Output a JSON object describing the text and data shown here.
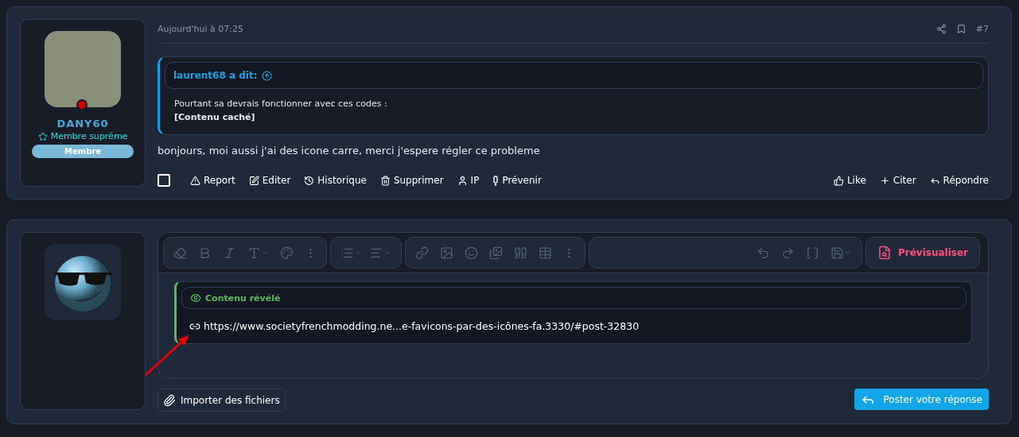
{
  "post": {
    "timestamp": "Aujourd'hui à 07:25",
    "number": "#7",
    "author": {
      "name": "DANY60",
      "title": "Membre suprême",
      "badge": "Membre",
      "online": true
    },
    "quote": {
      "author": "laurent68 a dit:",
      "lines": [
        {
          "text": "Pourtant sa devrais fonctionner avec ces codes :",
          "kind": "plain"
        },
        {
          "text": "[Contenu caché]",
          "kind": "bold"
        }
      ]
    },
    "message": "bonjours, moi aussi j'ai des icone carre, merci j'espere régler ce probleme",
    "select": {
      "checked": false
    },
    "actions": [
      {
        "label": "Report",
        "kind": "report"
      },
      {
        "label": "Editer",
        "kind": "edit"
      },
      {
        "label": "Historique",
        "kind": "history"
      },
      {
        "label": "Supprimer",
        "kind": "delete"
      },
      {
        "label": "IP",
        "kind": "ip"
      },
      {
        "label": "Prévenir",
        "kind": "warn"
      }
    ],
    "reactions": [
      {
        "label": "Like",
        "kind": "like"
      },
      {
        "label": "Citer",
        "kind": "quote"
      },
      {
        "label": "Répondre",
        "kind": "reply"
      }
    ]
  },
  "editor": {
    "preview_button": "Prévisualiser",
    "spoiler": {
      "title": "Contenu révélé",
      "link": "https://www.societyfrenchmodding.ne...e-favicons-par-des-icônes-fa.3330/#post-32830"
    },
    "attach_button": "Importer des fichiers",
    "submit_button": "Poster votre réponse"
  }
}
